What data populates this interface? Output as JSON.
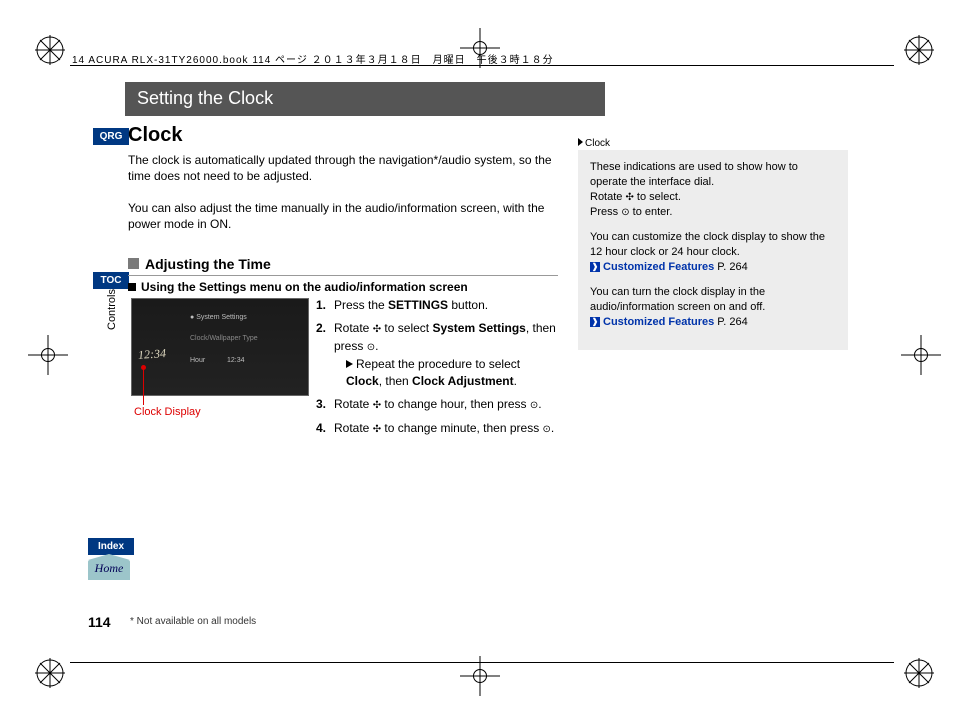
{
  "header_line": "14 ACURA RLX-31TY26000.book  114 ページ  ２０１３年３月１８日　月曜日　午後３時１８分",
  "title_bar": "Setting the Clock",
  "nav": {
    "qrg": "QRG",
    "toc": "TOC",
    "index": "Index",
    "home": "Home"
  },
  "side_label": "Controls",
  "clock_heading": "Clock",
  "intro1": "The clock is automatically updated through the navigation*/audio system, so the time does not need to be adjusted.",
  "intro2": "You can also adjust the time manually in the audio/information screen, with the power mode in ON.",
  "subhead": "Adjusting the Time",
  "subsubhead": "Using the Settings menu on the audio/information screen",
  "screen": {
    "clock_value": "12:34",
    "menu1": "System Settings",
    "menu2": "Clock/Wallpaper Type",
    "menu3a": "Hour",
    "menu3b": "12:34"
  },
  "clock_display_label": "Clock Display",
  "steps": {
    "s1_a": "Press the ",
    "s1_b": "SETTINGS",
    "s1_c": " button.",
    "s2_a": "Rotate ",
    "s2_b": " to select ",
    "s2_c": "System Settings",
    "s2_d": ", then press ",
    "s2_e": ".",
    "s2_ind_a": "Repeat the procedure to select ",
    "s2_ind_b": "Clock",
    "s2_ind_c": ", then ",
    "s2_ind_d": "Clock Adjustment",
    "s2_ind_e": ".",
    "s3_a": "Rotate ",
    "s3_b": " to change hour, then press ",
    "s3_c": ".",
    "s4_a": "Rotate ",
    "s4_b": " to change minute, then press ",
    "s4_c": "."
  },
  "sidebox": {
    "title": "Clock",
    "p1": "These indications are used to show how to operate the interface dial.",
    "p1b_a": "Rotate ",
    "p1b_b": " to select.",
    "p1c_a": "Press ",
    "p1c_b": " to enter.",
    "p2": "You can customize the clock display to show the 12 hour clock or 24 hour clock.",
    "link_text": "Customized Features",
    "link_page": " P. 264",
    "p3": "You can turn the clock display in the audio/information screen on and off."
  },
  "page_no": "114",
  "footnote": "* Not available on all models"
}
